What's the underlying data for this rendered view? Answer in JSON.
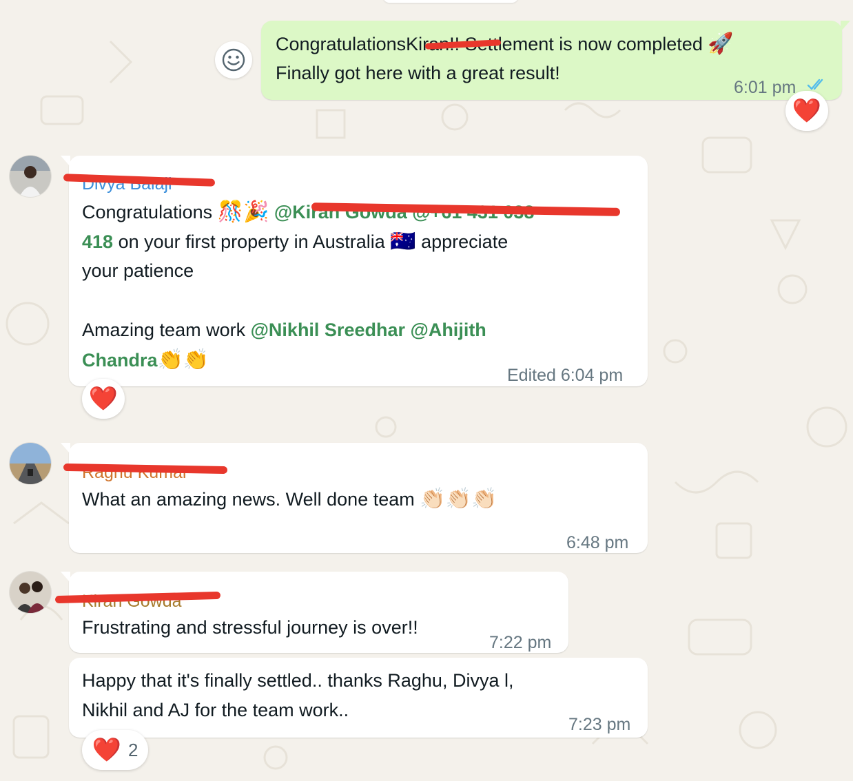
{
  "colors": {
    "background": "#f4f1eb",
    "incoming_bubble": "#ffffff",
    "outgoing_bubble": "#dcf8c6",
    "mention": "#3b8f55",
    "timestamp": "#667781",
    "read_ticks": "#53bdeb",
    "reaction_heart": "#e3242b",
    "redaction_scribble": "#e8372c"
  },
  "messages": [
    {
      "direction": "outgoing",
      "line1_a": "Congratulations",
      "line1_redacted": "Kiran",
      "line1_b": "!! Settlement is now completed",
      "line1_emoji": "🚀",
      "line2": "Finally got here with a great result!",
      "time": "6:01 pm",
      "status_icon": "double-check-read-icon",
      "reaction_emoji": "❤️"
    },
    {
      "direction": "incoming",
      "sender": "Divya Balaji",
      "avatar_icon": "avatar-woman-icon",
      "line1_text": "Congratulations",
      "line1_emoji": "🎊🎉",
      "line1_mention": "@Kiran Gowda @+61 431 038",
      "line2_mention": "418",
      "line2_text": " on your first property in Australia",
      "line2_flag": "🇦🇺",
      "line2_tail": " appreciate",
      "line3": "your patience",
      "line4_text": "Amazing team work ",
      "line4_mention": "@Nikhil Sreedhar @Ahijith",
      "line5_mention": "Chandra",
      "line5_emoji": "👏👏",
      "time": "Edited 6:04 pm",
      "reaction_emoji": "❤️"
    },
    {
      "direction": "incoming",
      "sender": "Raghu Kumar",
      "avatar_icon": "avatar-road-icon",
      "text": "What an amazing news. Well done team",
      "emoji": "👏🏻👏🏻👏🏻",
      "time": "6:48 pm"
    },
    {
      "direction": "incoming",
      "sender": "Kiran Gowda",
      "avatar_icon": "avatar-couple-icon",
      "text": "Frustrating and stressful journey is over!!",
      "time": "7:22 pm"
    },
    {
      "direction": "incoming",
      "line1": "Happy that it's finally settled.. thanks Raghu, Divya l,",
      "line2": "Nikhil and AJ for the team work..",
      "time": "7:23 pm",
      "reaction_emoji": "❤️",
      "reaction_count": "2"
    }
  ]
}
